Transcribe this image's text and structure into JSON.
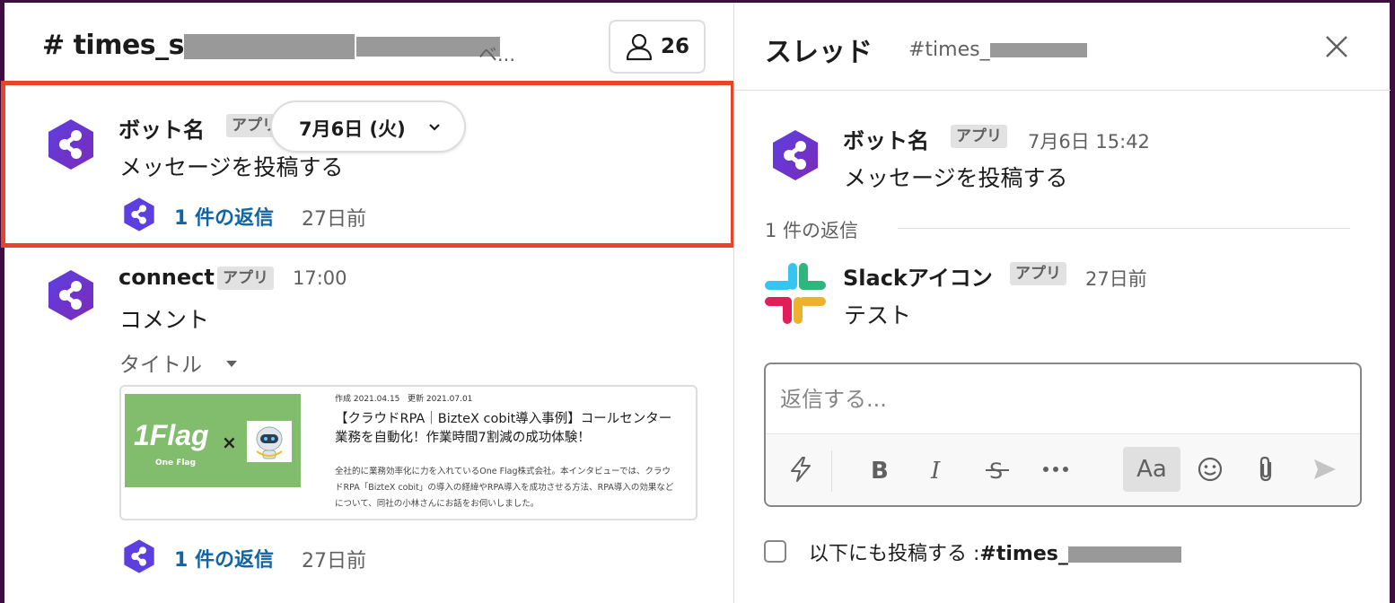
{
  "channel": {
    "title": "# times_s",
    "desc_suffix": "ベ...",
    "member_count": "26",
    "date_pill": "7月6日 (火)"
  },
  "messages": [
    {
      "sender": "ボット名",
      "badge": "アプリ",
      "text": "メッセージを投稿する",
      "reply_link": "1 件の返信",
      "reply_age": "27日前"
    },
    {
      "sender": "connect",
      "badge": "アプリ",
      "time": "17:00",
      "text": "コメント",
      "attachment_title": "タイトル",
      "unfurl": {
        "meta_created": "作成 2021.04.15",
        "meta_updated": "更新 2021.07.01",
        "headline": "【クラウドRPA｜BizteX cobit導入事例】コールセンター業務を自動化！作業時間7割減の成功体験！",
        "body": "全社的に業務効率化に力を入れているOne Flag株式会社。本インタビューでは、クラウドRPA「BizteX cobit」の導入の経緯やRPA導入を成功させる方法、RPA導入の効果などについて、同社の小林さんにお話をお伺いしました。",
        "image_logo": "1Flag",
        "image_logo_sub": "One Flag",
        "image_cross": "×"
      },
      "reply_link": "1 件の返信",
      "reply_age": "27日前"
    }
  ],
  "thread": {
    "title": "スレッド",
    "channel": "#times_",
    "parent": {
      "sender": "ボット名",
      "badge": "アプリ",
      "time": "7月6日 15:42",
      "text": "メッセージを投稿する"
    },
    "replies_label": "1 件の返信",
    "reply": {
      "sender": "Slackアイコン",
      "badge": "アプリ",
      "time": "27日前",
      "text": "テスト"
    },
    "composer": {
      "placeholder": "返信する...",
      "format_aa": "Aa"
    },
    "also_send_prefix": "以下にも投稿する :",
    "also_send_channel": "#times_"
  },
  "colors": {
    "accent_link": "#1264a3",
    "highlight_border": "#e8442b",
    "sidebar": "#3f0e40",
    "bot_avatar": "#5b2fd0"
  }
}
